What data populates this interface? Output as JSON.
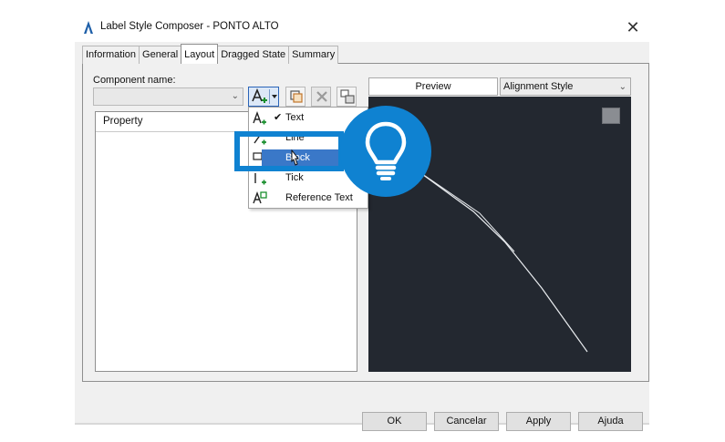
{
  "window": {
    "title": "Label Style Composer - PONTO ALTO",
    "close_glyph": "✕"
  },
  "tabs": [
    {
      "label": "Information",
      "active": false
    },
    {
      "label": "General",
      "active": false
    },
    {
      "label": "Layout",
      "active": true
    },
    {
      "label": "Dragged State",
      "active": false
    },
    {
      "label": "Summary",
      "active": false
    }
  ],
  "component": {
    "label": "Component name:",
    "value": ""
  },
  "toolbar": {
    "add_icon": "add-text-component-icon",
    "copy_icon": "copy-component-icon",
    "delete_icon": "delete-component-icon",
    "order_icon": "component-draw-order-icon"
  },
  "properties": {
    "header": "Property"
  },
  "dropdown_menu": {
    "items": [
      {
        "label": "Text",
        "checked": true,
        "icon": "text-component-icon"
      },
      {
        "label": "Line",
        "checked": false,
        "icon": "line-component-icon"
      },
      {
        "label": "Block",
        "checked": false,
        "icon": "block-component-icon",
        "highlighted": true
      },
      {
        "label": "Tick",
        "checked": false,
        "icon": "tick-component-icon"
      },
      {
        "label": "Reference Text",
        "checked": false,
        "icon": "reference-text-component-icon"
      }
    ]
  },
  "preview": {
    "tab_label": "Preview",
    "style_select": "Alignment Style",
    "background": "#232830"
  },
  "overlay": {
    "color": "#0f82d1",
    "icon": "lightbulb-icon"
  },
  "buttons": {
    "ok": "OK",
    "cancel": "Cancelar",
    "apply": "Apply",
    "help": "Ajuda"
  }
}
